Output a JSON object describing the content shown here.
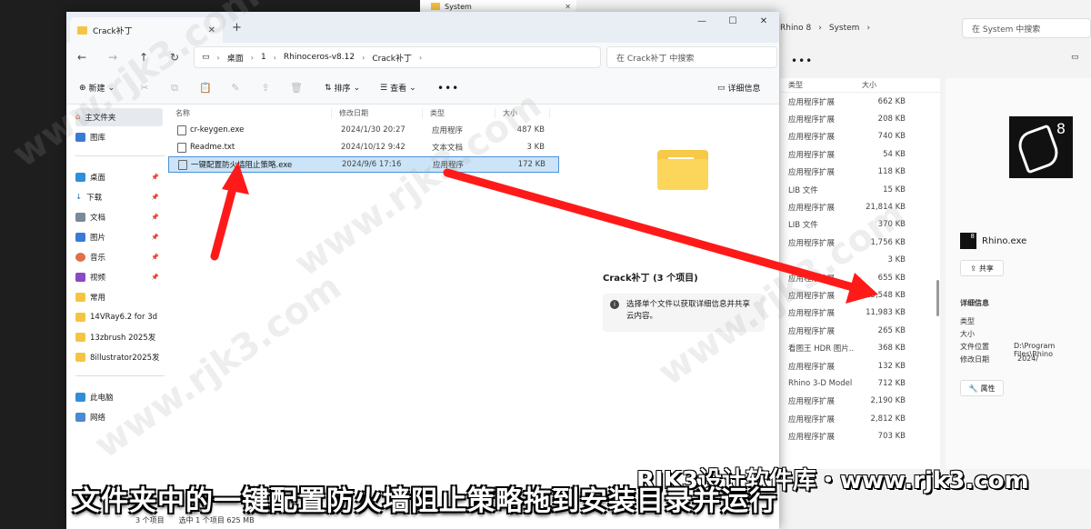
{
  "back_window": {
    "tab_title": "System",
    "breadcrumb": [
      "Rhino 8",
      "System"
    ],
    "search_placeholder": "在 System 中搜索",
    "col_type": "类型",
    "col_size": "大小",
    "rows": [
      {
        "type": "应用程序扩展",
        "size": "662 KB"
      },
      {
        "type": "应用程序扩展",
        "size": "208 KB"
      },
      {
        "type": "应用程序扩展",
        "size": "740 KB"
      },
      {
        "type": "应用程序扩展",
        "size": "54 KB"
      },
      {
        "type": "应用程序扩展",
        "size": "118 KB"
      },
      {
        "type": "LIB 文件",
        "size": "15 KB"
      },
      {
        "type": "应用程序扩展",
        "size": "21,814 KB"
      },
      {
        "type": "LIB 文件",
        "size": "370 KB"
      },
      {
        "type": "应用程序扩展",
        "size": "1,756 KB"
      },
      {
        "type": "",
        "size": "3 KB"
      },
      {
        "type": "应用程序扩展",
        "size": "655 KB"
      },
      {
        "type": "应用程序扩展",
        "size": "15,548 KB"
      },
      {
        "type": "应用程序扩展",
        "size": "11,983 KB"
      },
      {
        "type": "应用程序扩展",
        "size": "265 KB"
      },
      {
        "type": "看图王 HDR 图片...",
        "size": "368 KB"
      },
      {
        "type": "应用程序扩展",
        "size": "132 KB"
      },
      {
        "type": "Rhino 3-D Model",
        "size": "712 KB"
      },
      {
        "type": "应用程序扩展",
        "size": "2,190 KB"
      },
      {
        "type": "应用程序扩展",
        "size": "2,812 KB"
      },
      {
        "type": "应用程序扩展",
        "size": "703 KB"
      }
    ],
    "detail": {
      "file_name": "Rhino.exe",
      "share_label": "共享",
      "section": "详细信息",
      "fields": [
        {
          "k": "类型",
          "v": ""
        },
        {
          "k": "大小",
          "v": ""
        },
        {
          "k": "文件位置",
          "v": "D:\\Program Files\\Rhino"
        },
        {
          "k": "修改日期",
          "v": "2024/"
        }
      ],
      "props_label": "属性",
      "logo_digit": "8"
    },
    "details_btn": "详细信息"
  },
  "window": {
    "tab_title": "Crack补丁",
    "breadcrumb": [
      "桌面",
      "1",
      "Rhinoceros-v8.12",
      "Crack补丁"
    ],
    "search_placeholder": "在 Crack补丁 中搜索",
    "toolbar": {
      "new": "新建",
      "sort": "排序",
      "view": "查看",
      "details": "详细信息"
    },
    "sidebar": {
      "home": "主文件夹",
      "gallery": "图库",
      "pinned": [
        "桌面",
        "下载",
        "文档",
        "图片",
        "音乐",
        "视频"
      ],
      "folders": [
        "常用",
        "14VRay6.2 for 3d",
        "13zbrush 2025发",
        "8illustrator2025发"
      ],
      "pc": "此电脑",
      "network": "网络"
    },
    "columns": {
      "name": "名称",
      "date": "修改日期",
      "type": "类型",
      "size": "大小"
    },
    "files": [
      {
        "name": "cr-keygen.exe",
        "date": "2024/1/30 20:27",
        "type": "应用程序",
        "size": "487 KB"
      },
      {
        "name": "Readme.txt",
        "date": "2024/10/12 9:42",
        "type": "文本文档",
        "size": "3 KB"
      },
      {
        "name": "一键配置防火墙阻止策略.exe",
        "date": "2024/9/6 17:16",
        "type": "应用程序",
        "size": "172 KB"
      }
    ],
    "preview": {
      "title": "Crack补丁 (3 个项目)",
      "info": "选择单个文件以获取详细信息并共享云内容。"
    },
    "status": {
      "count": "3 个项目",
      "selected": "选中 1 个项目  625 MB"
    }
  },
  "overlay": {
    "subtitle": "文件夹中的一键配置防火墙阻止策略拖到安装目录并运行",
    "brand": "RJK3设计软件库・www.rjk3.com",
    "watermark": "www.rjk3.com",
    "arrow_color": "#ff1a1a"
  }
}
